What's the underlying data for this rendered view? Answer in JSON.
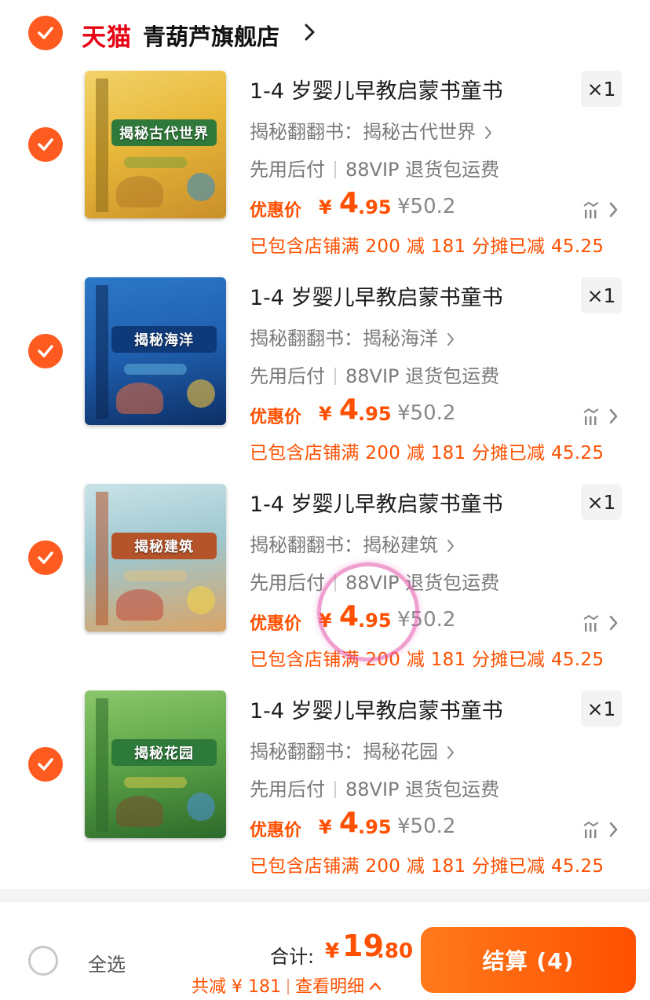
{
  "colors": {
    "accent": "#ff5000",
    "check": "#ff5a1f",
    "brand": "#e60012"
  },
  "shop": {
    "brand": "天猫",
    "name": "青葫芦旗舰店"
  },
  "items": [
    {
      "title": "1-4 岁婴儿早教启蒙书童书",
      "qty": "×1",
      "sku": "揭秘翻翻书：揭秘古代世界",
      "service_1": "先用后付",
      "service_2": "88VIP 退货包运费",
      "price_label": "优惠价",
      "price_symbol": "¥",
      "price_int": "4",
      "price_dec": ".95",
      "original_price": "¥50.2",
      "discount": "已包含店铺满 200 减 181 分摊已减 45.25",
      "cover_title": "揭秘古代世界",
      "cover_color": "#e8b83a",
      "cover_dark": "#8a6a1a"
    },
    {
      "title": "1-4 岁婴儿早教启蒙书童书",
      "qty": "×1",
      "sku": "揭秘翻翻书：揭秘海洋",
      "service_1": "先用后付",
      "service_2": "88VIP 退货包运费",
      "price_label": "优惠价",
      "price_symbol": "¥",
      "price_int": "4",
      "price_dec": ".95",
      "original_price": "¥50.2",
      "discount": "已包含店铺满 200 减 181 分摊已减 45.25",
      "cover_title": "揭秘海洋",
      "cover_color": "#1f5fae",
      "cover_dark": "#0d2f66"
    },
    {
      "title": "1-4 岁婴儿早教启蒙书童书",
      "qty": "×1",
      "sku": "揭秘翻翻书：揭秘建筑",
      "service_1": "先用后付",
      "service_2": "88VIP 退货包运费",
      "price_label": "优惠价",
      "price_symbol": "¥",
      "price_int": "4",
      "price_dec": ".95",
      "original_price": "¥50.2",
      "discount": "已包含店铺满 200 减 181 分摊已减 45.25",
      "cover_title": "揭秘建筑",
      "cover_color": "#9ec7cf",
      "cover_dark": "#b5542a"
    },
    {
      "title": "1-4 岁婴儿早教启蒙书童书",
      "qty": "×1",
      "sku": "揭秘翻翻书：揭秘花园",
      "service_1": "先用后付",
      "service_2": "88VIP 退货包运费",
      "price_label": "优惠价",
      "price_symbol": "¥",
      "price_int": "4",
      "price_dec": ".95",
      "original_price": "¥50.2",
      "discount": "已包含店铺满 200 减 181 分摊已减 45.25",
      "cover_title": "揭秘花园",
      "cover_color": "#5fa64a",
      "cover_dark": "#2c6a2a"
    }
  ],
  "footer": {
    "select_all": "全选",
    "total_label": "合计:",
    "total_symbol": "¥",
    "total_int": "19",
    "total_dec": ".80",
    "saved_label": "共减 ¥ 181",
    "details_label": "查看明细",
    "checkout_label": "结算 (4)"
  }
}
